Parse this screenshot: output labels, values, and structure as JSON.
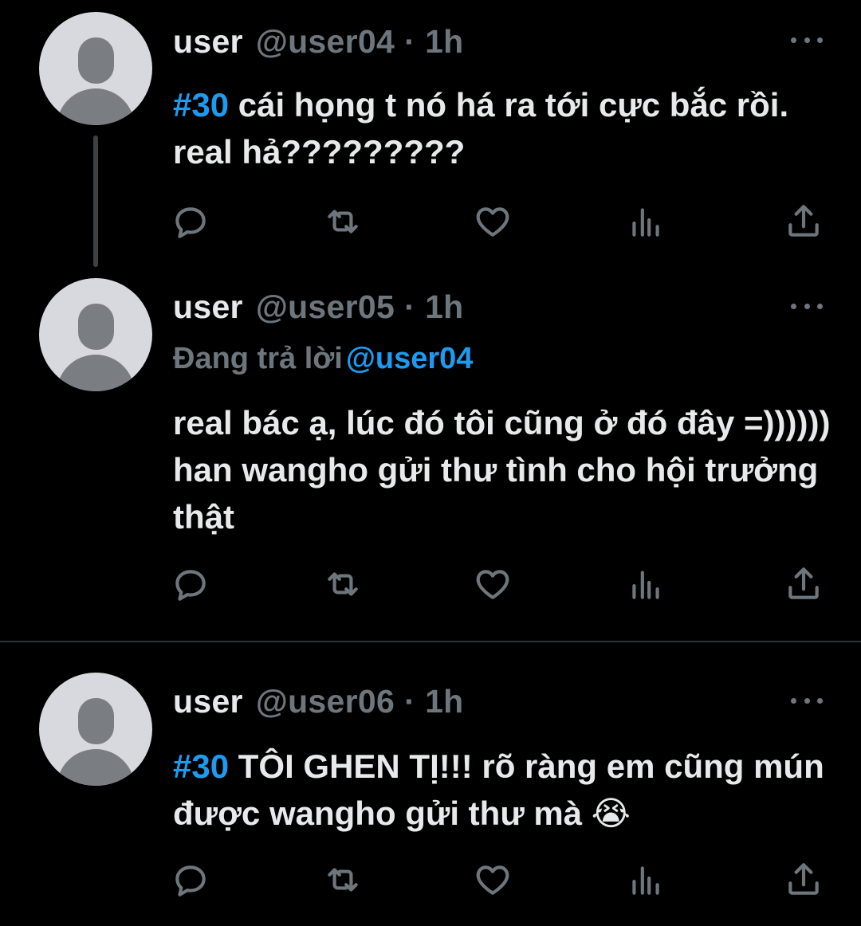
{
  "tweets": [
    {
      "name": "user",
      "handle": "@user04",
      "separator": "·",
      "time": "1h",
      "hashtag": "#30",
      "text": " cái họng t nó há ra tới cực bắc rồi. real hả?????????"
    },
    {
      "name": "user",
      "handle": "@user05",
      "separator": "·",
      "time": "1h",
      "reply_prefix": "Đang trả lời",
      "reply_mention": "@user04",
      "text": "real bác ạ, lúc đó tôi cũng ở đó đây =)))))) han wangho gửi thư tình cho hội trưởng thật"
    },
    {
      "name": "user",
      "handle": "@user06",
      "separator": "·",
      "time": "1h",
      "hashtag": "#30",
      "text": " TÔI GHEN TỊ!!! rõ ràng em cũng mún được wangho gửi thư mà ",
      "emoji": "😭"
    }
  ],
  "icons": {
    "reply": "reply-icon",
    "retweet": "retweet-icon",
    "like": "heart-icon",
    "views": "analytics-icon",
    "share": "share-icon",
    "more": "more-icon"
  },
  "colors": {
    "background": "#000000",
    "text": "#e7e9ea",
    "muted": "#6e767d",
    "link": "#1d9bf0",
    "avatar_bg": "#d8d9de",
    "avatar_fg": "#7a7d82"
  }
}
